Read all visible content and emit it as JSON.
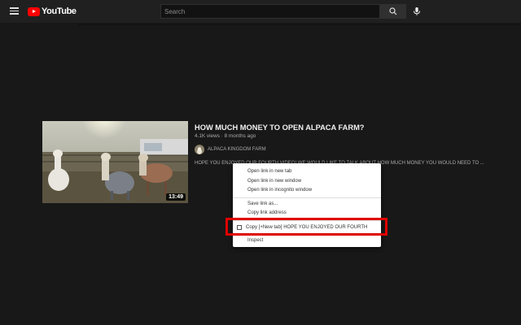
{
  "header": {
    "logo_text": "YouTube",
    "search_placeholder": "Search"
  },
  "video": {
    "title": "HOW MUCH MONEY TO OPEN ALPACA FARM?",
    "meta": "4.1K views · 8 months ago",
    "channel": "ALPACA KINGDOM FARM",
    "description": "HOPE YOU ENJOYED OUR FOURTH VIDEO! WE WOULD LIKE TO TALK ABOUT HOW MUCH MONEY YOU WOULD NEED TO ...",
    "duration": "13:49"
  },
  "context_menu": {
    "items": [
      "Open link in new tab",
      "Open link in new window",
      "Open link in incognito window",
      "Save link as...",
      "Copy link address",
      "Copy [+New tab] HOPE YOU ENJOYED OUR FOURTH",
      "Inspect"
    ]
  },
  "colors": {
    "background": "#181818",
    "topbar": "#202020",
    "brand_red": "#ff0000",
    "highlight_red": "#e00000"
  }
}
